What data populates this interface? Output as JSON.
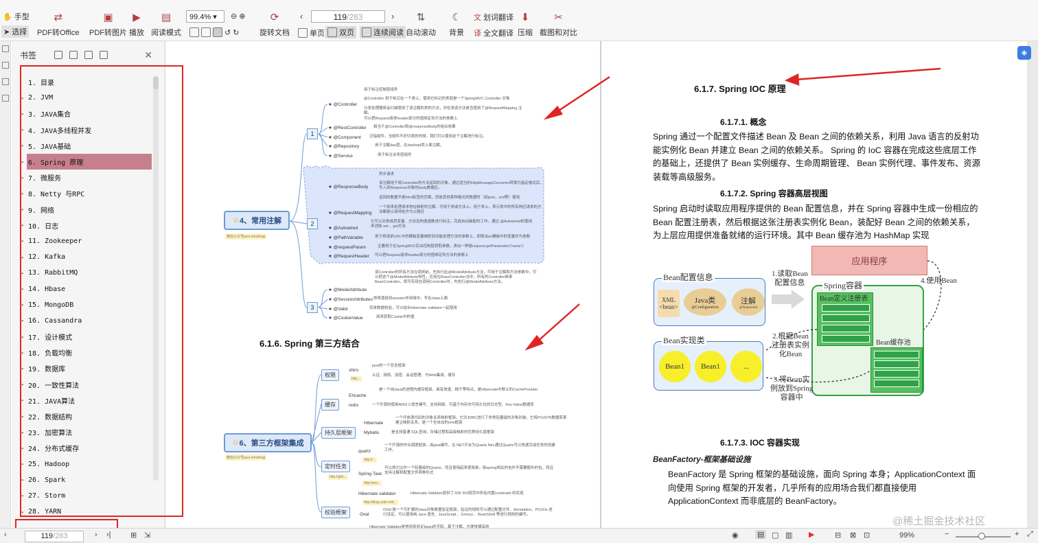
{
  "toolbar": {
    "hand": "手型",
    "select": "选择",
    "pdf_to_office": "PDF转Office",
    "pdf_to_image": "PDF转图片",
    "play": "播放",
    "read_mode": "阅读模式",
    "zoom": "99.4%",
    "rotate": "旋转文档",
    "single": "单页",
    "double": "双页",
    "continuous": "连续阅读",
    "page_current": "119",
    "page_total": "/283",
    "auto_scroll": "自动滚动",
    "background": "背景",
    "word_translate": "划词翻译",
    "full_translate": "全文翻译",
    "compress": "压缩",
    "screenshot": "截图和对比"
  },
  "bookmark_panel": {
    "title": "书签",
    "items": [
      {
        "label": "1. 目录",
        "arrow": false,
        "selected": false
      },
      {
        "label": "2. JVM",
        "arrow": true,
        "selected": false
      },
      {
        "label": "3. JAVA集合",
        "arrow": true,
        "selected": false
      },
      {
        "label": "4. JAVA多线程并发",
        "arrow": true,
        "selected": false
      },
      {
        "label": "5. JAVA基础",
        "arrow": true,
        "selected": false
      },
      {
        "label": "6. Spring 原理",
        "arrow": true,
        "selected": true
      },
      {
        "label": "7.   微服务",
        "arrow": true,
        "selected": false
      },
      {
        "label": "8. Netty 与RPC",
        "arrow": true,
        "selected": false
      },
      {
        "label": "9. 网络",
        "arrow": true,
        "selected": false
      },
      {
        "label": "10. 日志",
        "arrow": true,
        "selected": false
      },
      {
        "label": "11. Zookeeper",
        "arrow": true,
        "selected": false
      },
      {
        "label": "12. Kafka",
        "arrow": true,
        "selected": false
      },
      {
        "label": "13. RabbitMQ",
        "arrow": true,
        "selected": false
      },
      {
        "label": "14. Hbase",
        "arrow": true,
        "selected": false
      },
      {
        "label": "15. MongoDB",
        "arrow": true,
        "selected": false
      },
      {
        "label": "16. Cassandra",
        "arrow": true,
        "selected": false
      },
      {
        "label": "17. 设计模式",
        "arrow": true,
        "selected": false
      },
      {
        "label": "18. 负载均衡",
        "arrow": true,
        "selected": false
      },
      {
        "label": "19. 数据库",
        "arrow": true,
        "selected": false
      },
      {
        "label": "20. 一致性算法",
        "arrow": true,
        "selected": false
      },
      {
        "label": "21. JAVA算法",
        "arrow": true,
        "selected": false
      },
      {
        "label": "22. 数据结构",
        "arrow": true,
        "selected": false
      },
      {
        "label": "23. 加密算法",
        "arrow": true,
        "selected": false
      },
      {
        "label": "24. 分布式缓存",
        "arrow": true,
        "selected": false
      },
      {
        "label": "25. Hadoop",
        "arrow": true,
        "selected": false
      },
      {
        "label": "26. Spark",
        "arrow": true,
        "selected": false
      },
      {
        "label": "27. Storm",
        "arrow": true,
        "selected": false
      },
      {
        "label": "28. YARN",
        "arrow": true,
        "selected": false
      }
    ]
  },
  "left_page": {
    "mindmap1": {
      "root": "4、常用注解",
      "root_tag": "微信公众号java-mindmap",
      "groups": [
        "1",
        "2",
        "3"
      ],
      "nodes": [
        "@Controller",
        "@RestController",
        "@Component",
        "@Repository",
        "@Service",
        "@ResponseBody",
        "@RequestMapping",
        "@Autowired",
        "@PathVariable",
        "@requestParam",
        "@RequestHeader",
        "@ModelAttribute",
        "@SessionAttributes",
        "@Valid",
        "@CookieValue"
      ],
      "descs": [
        "用于标注控制层组件",
        "@Controller 用于标记在一个类上，使用它标记的类就是一个SpringMVC Controller 对象",
        "分发处理器将会扫描使用了该注解的类的方法，并检测该方法是否使用了@RequestMapping 注解。",
        "可以把Request请求header部分的值绑定到方法的参数上",
        "相当于@Controller和@responseBody的组合效果",
        "泛指组件，当组件不好归类的时候，我们可以使用这个注解进行标注。",
        "用于注解dao层，在daoImpl类上面注解。",
        "用于标注业务层组件",
        "异步请求",
        "该注解用于将Controller的方法返回的对象，通过适当的HttpMessageConverter转换为指定格式后，写入到Response对象的body数据区。",
        "返回的数据不是html标签的页面，而是其他某种格式的数据时（如json、xml等）使用",
        "一个用来处理请求地址映射的注解，可用于类或方法上。用于类上，表示类中的所有响应请求的方法都是以该地址作为父路径",
        "它可以对类成员变量、方法及构造函数进行标注，完成自动装配的工作。通过 @Autowired的使用来消除 set ，get方法",
        "用于将请求URL中的模板变量映射到功能处理方法的参数上，即取出uri模板中的变量作为参数",
        "主要用于在SpringMVC后台控制层获取参数，类似一种是request.getParameter(\"name\")",
        "可以把Request请求header部分的值绑定到方法的参数上",
        "该Controller的所有方法在调用前，先执行此@ModelAttribute方法，可用于注解和方法参数中，可以把这个@ModelAttribute特性，应用在BaseController当中，所有的Controller继承BaseController，即可实现在调用Controller时，先执行@ModelAttribute方法。",
        "即将值放到session作用域中，写在class上面",
        "实体数据校验，可以结合hibernate validator一起使用",
        "用来获取Cookie中的值"
      ]
    },
    "section_616": "6.1.6.  Spring 第三方结合",
    "mindmap2": {
      "root": "6、第三方框架集成",
      "root_tag": "微信公众号java-mindmap",
      "categories": [
        "权限",
        "缓存",
        "持久层框架",
        "定时任务",
        "校验框架"
      ],
      "nodes": [
        "shiro",
        "Ehcache",
        "redis",
        "Hibernate",
        "Mybatis",
        "quartz",
        "Spring-Task",
        "Hibernate validator",
        "Oval"
      ],
      "tags": [
        "http...",
        "http://...",
        "http://gith...",
        "http://ww...",
        "http://blog.csdn.net/..."
      ],
      "descs": [
        "java的一个安全框架",
        "认证、授权、加密、会话管理、与Web集成、缓存",
        "是一个纯Java的进程内缓存框架，具有快速、精干等特点，是Hibernate中默认的CacheProvider",
        "一个开源的使用ANSI C语言编写、支持网络、可基于内存亦可持久化的日志型、Key-Value数据库",
        "一个开放源代码的对象关系映射框架，它对JDBC进行了非常轻量级的对象封装，它将POJO与数据库表建立映射关系，是一个全自动的orm框架",
        "是支持普通 SQL查询，存储过程和高级映射的优秀持久层框架",
        "一个开源的作业调度框架，由java编写，在.NET平台为Quartz.Net,通过Quartz可以快速完成任务的创建工作。",
        "可以将它比作一个轻量级的Quartz，而且使用起来很简单，除spring相关的包外不需要额外的包，而且支持注解和配置文件两种形式",
        "Hibernate Validator提供了JSR 303规范中所有内置constraint 的实现",
        "OVal 是一个可扩展的Java对象数据验证框架，验证的规则可以通过配置文件、Annotation、POJOs 进行设定。可以使用纯 Java 语言、JavaScript 、Groovy 、BeanShell 等进行规则的编写。",
        "Hibernate Validator是常用来验证bean的字段，基于注解，方便快捷高效"
      ]
    }
  },
  "right_page": {
    "h_617": "6.1.7.  Spring IOC 原理",
    "h_6171": "6.1.7.1.      概念",
    "p1": "Spring 通过一个配置文件描述 Bean 及 Bean 之间的依赖关系，利用 Java 语言的反射功能实例化 Bean 并建立 Bean 之间的依赖关系。 Spring 的 IoC 容器在完成这些底层工作的基础上，还提供了 Bean 实例缓存、生命周期管理、 Bean 实例代理、事件发布、资源装载等高级服务。",
    "h_6172": "6.1.7.2.      Spring 容器高层视图",
    "p2": "Spring 启动时读取应用程序提供的 Bean 配置信息，并在 Spring 容器中生成一份相应的 Bean 配置注册表，然后根据这张注册表实例化 Bean，装配好 Bean 之间的依赖关系，为上层应用提供准备就绪的运行环境。其中 Bean 缓存池为 HashMap 实现",
    "diagram": {
      "app": "应用程序",
      "bean_config": "Bean配置信息",
      "xml": "XML\n<bean>",
      "java_class": "Java类",
      "java_class_sub": "@Configuration",
      "annotation": "注解",
      "annotation_sub": "@Autowired",
      "step1": "1.读取Bean\n配置信息",
      "container": "Spring容器",
      "registry": "Bean定义注册表",
      "step4": "4.使用Bean",
      "impl": "Bean实现类",
      "bean1": "Bean1",
      "bean2": "Bean1",
      "dots": "...",
      "step2": "2.根据Bean\n注册表实例\n化Bean",
      "cache": "Bean缓存池",
      "step3": "3.将Bean实\n例放到Spring\n容器中"
    },
    "h_6173": "6.1.7.3.      IOC 容器实现",
    "bf_title": "BeanFactory-框架基础设施",
    "p3": "BeanFactory 是 Spring 框架的基础设施，面向 Spring 本身；ApplicationContext 面向使用 Spring 框架的开发者，几乎所有的应用场合我们都直接使用 ApplicationContext 而非底层的 BeanFactory。"
  },
  "statusbar": {
    "page_current": "119",
    "page_total": "/283",
    "zoom": "99%"
  },
  "watermark": "@稀土掘金技术社区",
  "colors": {
    "selected_bookmark": "#c77f8d",
    "annotation_red": "#e02424",
    "mindmap_blue": "#6c9bd6",
    "bean_green": "#2fa24a",
    "app_pink": "#f2b8b4"
  }
}
